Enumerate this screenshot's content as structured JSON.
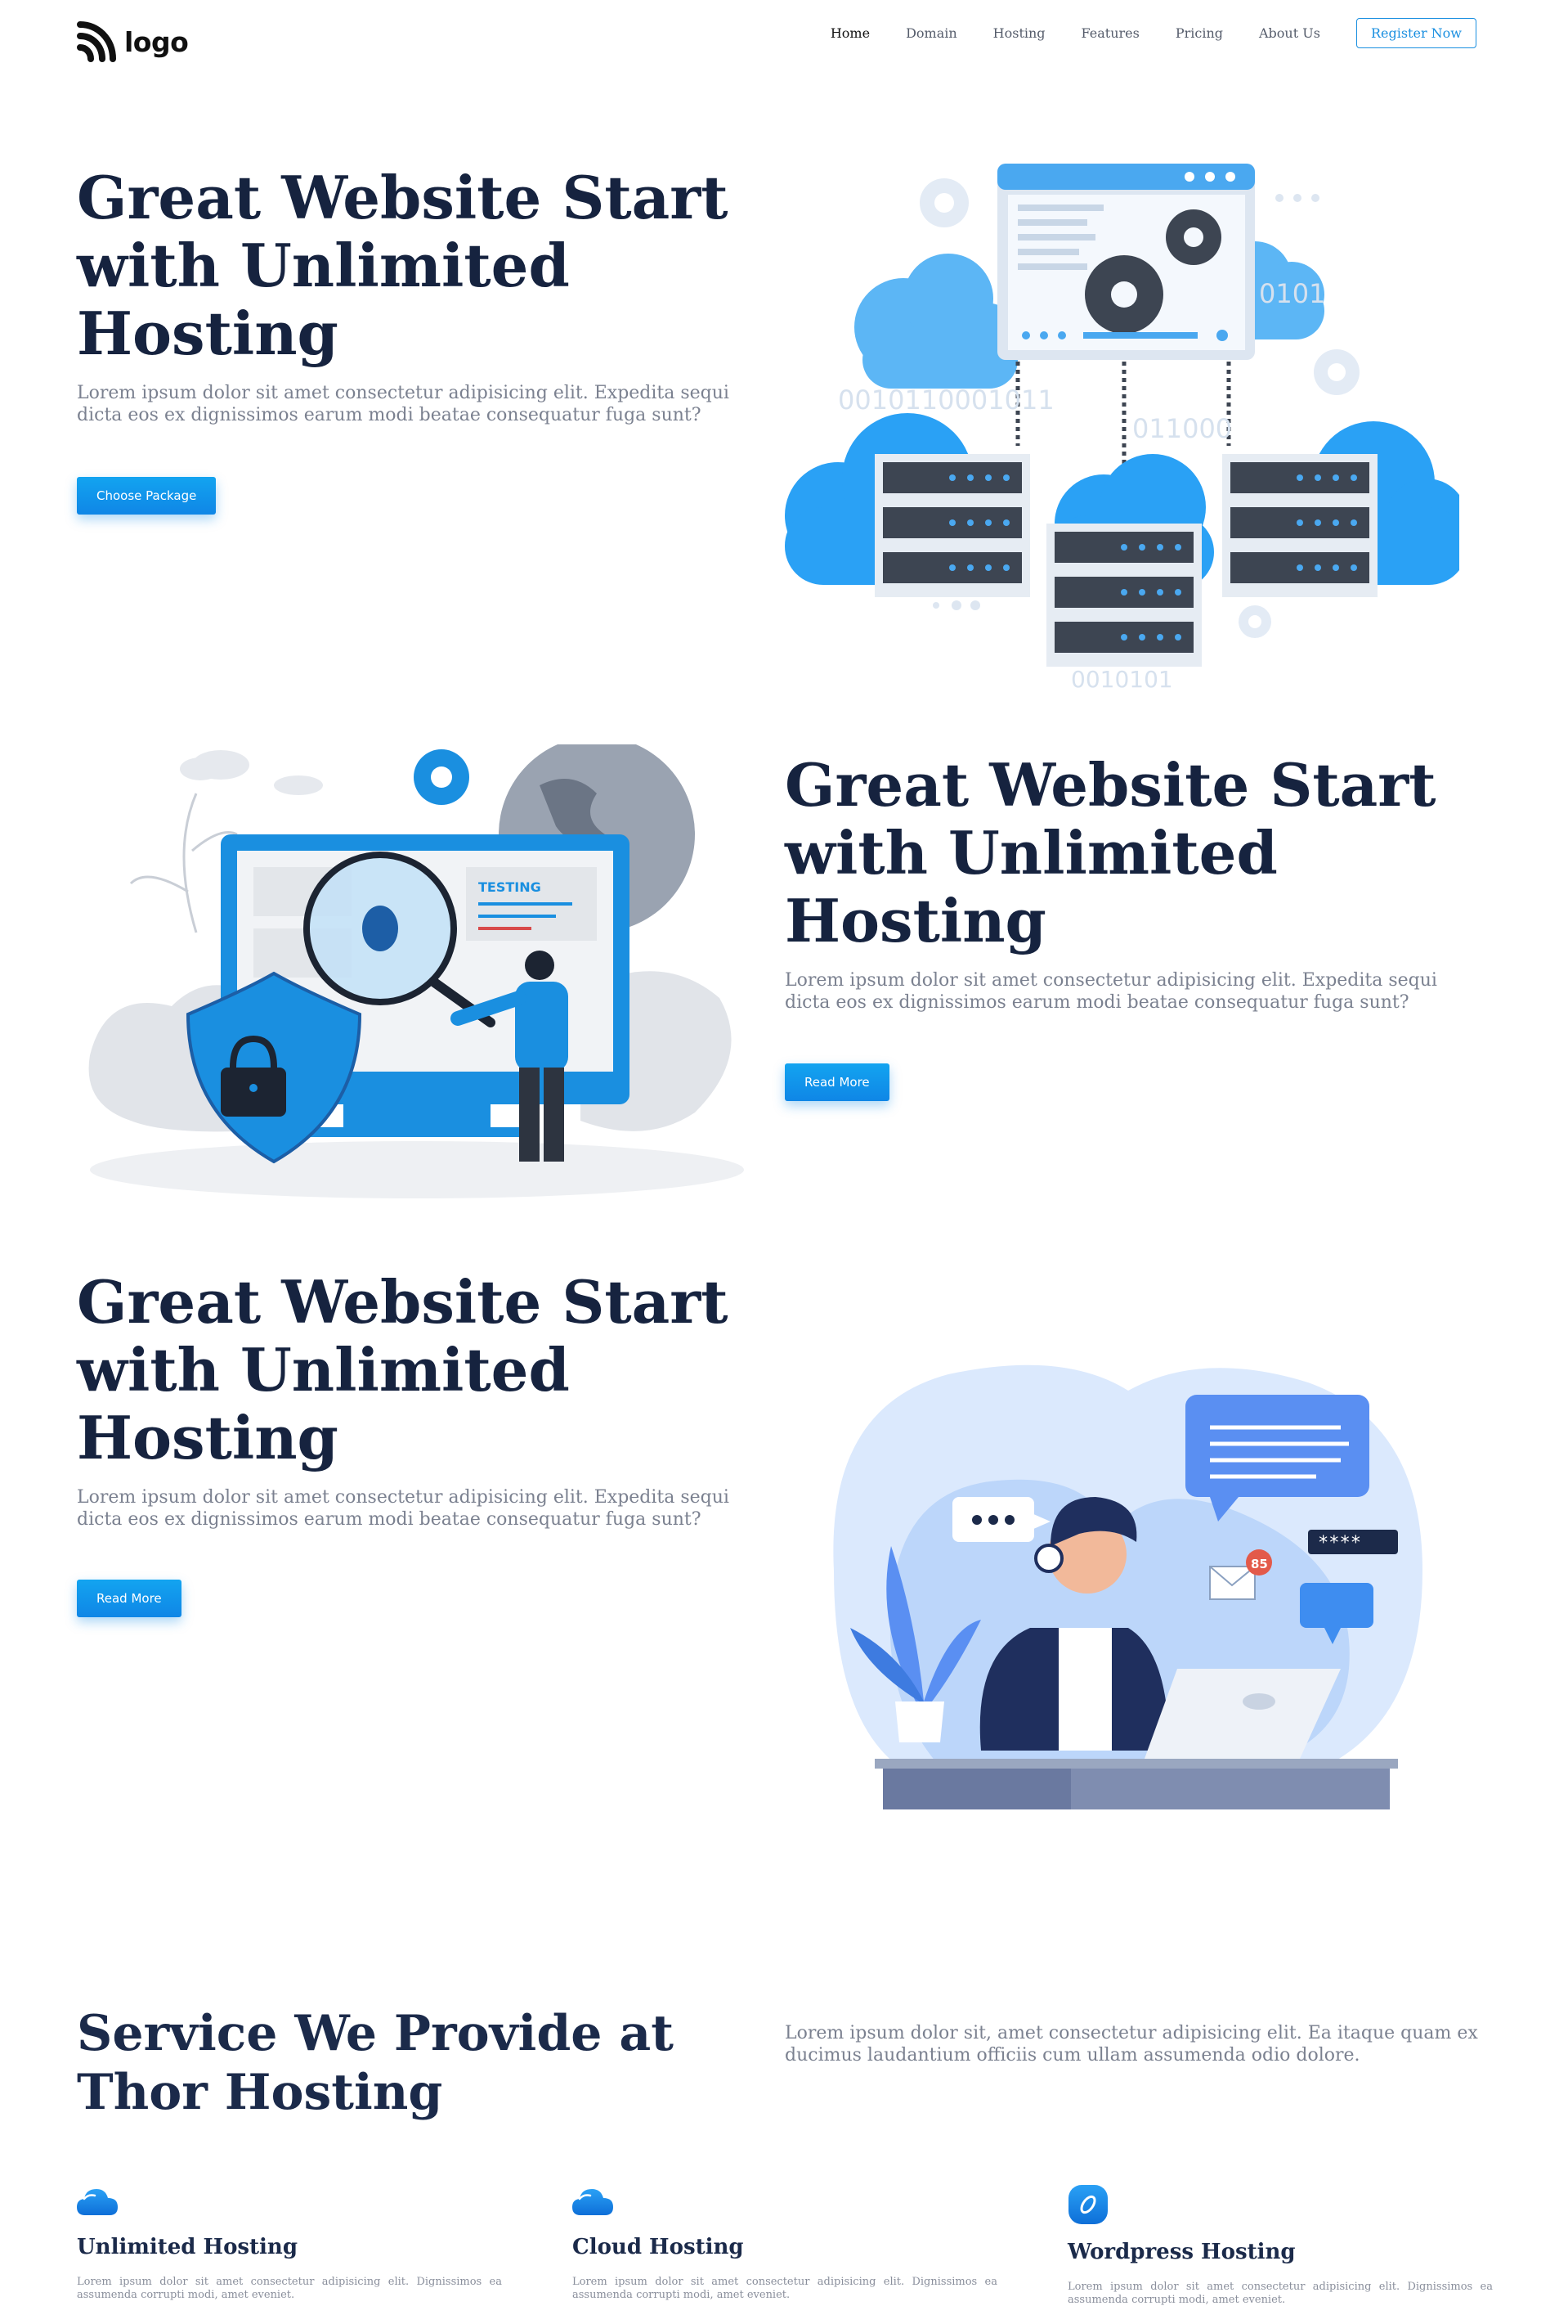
{
  "brand": {
    "logo_text": "logo"
  },
  "nav": {
    "items": [
      {
        "label": "Home",
        "active": true
      },
      {
        "label": "Domain",
        "active": false
      },
      {
        "label": "Hosting",
        "active": false
      },
      {
        "label": "Features",
        "active": false
      },
      {
        "label": "Pricing",
        "active": false
      },
      {
        "label": "About Us",
        "active": false
      }
    ],
    "register_label": "Register Now"
  },
  "hero1": {
    "title": "Great Website Start with Unlimited Hosting",
    "lead": "Lorem ipsum dolor sit amet consectetur adipisicing elit. Expedita sequi dicta eos ex dignissimos earum modi beatae consequatur fuga sunt?",
    "button": "Choose Package",
    "binary_1": "0010110001011",
    "binary_2": "011000",
    "binary_3": "0101",
    "binary_4": "0010101"
  },
  "hero2": {
    "title": "Great Website Start with Unlimited Hosting",
    "lead": "Lorem ipsum dolor sit amet consectetur adipisicing elit. Expedita sequi dicta eos ex dignissimos earum modi beatae consequatur fuga sunt?",
    "button": "Read More",
    "screen_label": "TESTING"
  },
  "hero3": {
    "title": "Great Website Start with Unlimited Hosting",
    "lead": "Lorem ipsum dolor sit amet consectetur adipisicing elit. Expedita sequi dicta eos ex dignissimos earum modi beatae consequatur fuga sunt?",
    "button": "Read More",
    "badge_count": "85",
    "password_mask": "****"
  },
  "services": {
    "title": "Service We Provide at Thor Hosting",
    "lead": "Lorem ipsum dolor sit, amet consectetur adipisicing elit. Ea itaque quam ex ducimus laudantium officiis cum ullam assumenda odio dolore.",
    "cards": [
      {
        "icon": "cloud-icon",
        "title": "Unlimited Hosting",
        "text": "Lorem ipsum dolor sit amet consectetur adipisicing elit. Dignissimos ea assumenda corrupti modi, amet eveniet."
      },
      {
        "icon": "cloud-icon",
        "title": "Cloud Hosting",
        "text": "Lorem ipsum dolor sit amet consectetur adipisicing elit. Dignissimos ea assumenda corrupti modi, amet eveniet."
      },
      {
        "icon": "wordpress-icon",
        "title": "Wordpress Hosting",
        "text": "Lorem ipsum dolor sit amet consectetur adipisicing elit. Dignissimos ea assumenda corrupti modi, amet eveniet."
      }
    ]
  },
  "colors": {
    "primary": "#1a8fe0",
    "heading": "#16233f",
    "muted": "#7b8190"
  }
}
